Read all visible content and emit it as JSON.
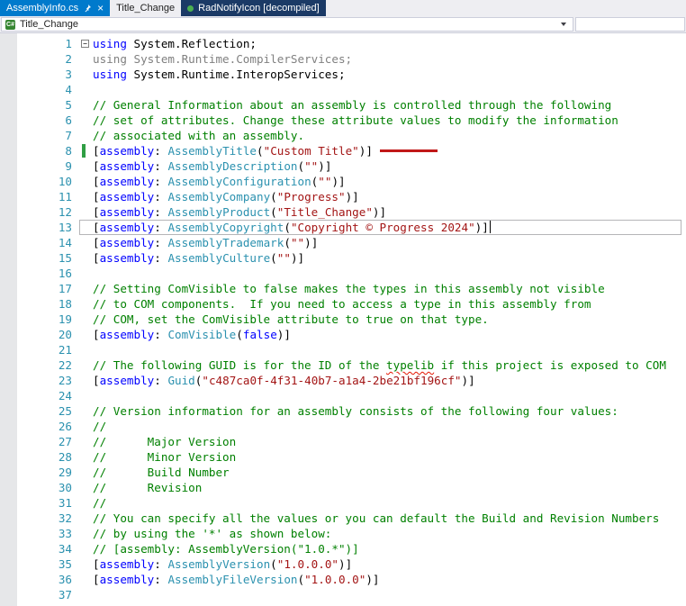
{
  "tabs": [
    {
      "label": "AssemblyInfo.cs",
      "active": true
    },
    {
      "label": "Title_Change",
      "active": false
    },
    {
      "label": "RadNotifyIcon [decompiled]",
      "active": false
    }
  ],
  "navbar": {
    "project_dropdown": {
      "value": "Title_Change",
      "icon": "csharp-project-icon"
    }
  },
  "colors": {
    "active_tab": "#007acc",
    "decompiled_tab": "#1b3a66",
    "keyword": "#0000ff",
    "type": "#2b91af",
    "string": "#a31515",
    "comment": "#008000",
    "unused_code": "#808080",
    "line_number": "#2b91af",
    "change_bar": "#2f9e44",
    "annotation_line": "#c11818",
    "squiggle": "#e51400"
  },
  "editor": {
    "lines": [
      {
        "n": 1,
        "collapse": true,
        "seg": [
          [
            "kw",
            "using"
          ],
          [
            "tx",
            " System.Reflection;"
          ]
        ]
      },
      {
        "n": 2,
        "seg": [
          [
            "gy",
            "using System.Runtime.CompilerServices;"
          ]
        ]
      },
      {
        "n": 3,
        "seg": [
          [
            "kw",
            "using"
          ],
          [
            "tx",
            " System.Runtime.InteropServices;"
          ]
        ]
      },
      {
        "n": 4,
        "seg": []
      },
      {
        "n": 5,
        "seg": [
          [
            "cm",
            "// General Information about an assembly is controlled through the following"
          ]
        ]
      },
      {
        "n": 6,
        "seg": [
          [
            "cm",
            "// set of attributes. Change these attribute values to modify the information"
          ]
        ]
      },
      {
        "n": 7,
        "seg": [
          [
            "cm",
            "// associated with an assembly."
          ]
        ]
      },
      {
        "n": 8,
        "changebar": true,
        "annotation": true,
        "seg": [
          [
            "tx",
            "["
          ],
          [
            "kw",
            "assembly"
          ],
          [
            "tx",
            ": "
          ],
          [
            "ty",
            "AssemblyTitle"
          ],
          [
            "tx",
            "("
          ],
          [
            "st",
            "\"Custom Title\""
          ],
          [
            "tx",
            ")]"
          ]
        ]
      },
      {
        "n": 9,
        "seg": [
          [
            "tx",
            "["
          ],
          [
            "kw",
            "assembly"
          ],
          [
            "tx",
            ": "
          ],
          [
            "ty",
            "AssemblyDescription"
          ],
          [
            "tx",
            "("
          ],
          [
            "st",
            "\"\""
          ],
          [
            "tx",
            ")]"
          ]
        ]
      },
      {
        "n": 10,
        "seg": [
          [
            "tx",
            "["
          ],
          [
            "kw",
            "assembly"
          ],
          [
            "tx",
            ": "
          ],
          [
            "ty",
            "AssemblyConfiguration"
          ],
          [
            "tx",
            "("
          ],
          [
            "st",
            "\"\""
          ],
          [
            "tx",
            ")]"
          ]
        ]
      },
      {
        "n": 11,
        "seg": [
          [
            "tx",
            "["
          ],
          [
            "kw",
            "assembly"
          ],
          [
            "tx",
            ": "
          ],
          [
            "ty",
            "AssemblyCompany"
          ],
          [
            "tx",
            "("
          ],
          [
            "st",
            "\"Progress\""
          ],
          [
            "tx",
            ")]"
          ]
        ]
      },
      {
        "n": 12,
        "seg": [
          [
            "tx",
            "["
          ],
          [
            "kw",
            "assembly"
          ],
          [
            "tx",
            ": "
          ],
          [
            "ty",
            "AssemblyProduct"
          ],
          [
            "tx",
            "("
          ],
          [
            "st",
            "\"Title_Change\""
          ],
          [
            "tx",
            ")]"
          ]
        ]
      },
      {
        "n": 13,
        "current": true,
        "cursor": true,
        "seg": [
          [
            "tx",
            "["
          ],
          [
            "kw",
            "assembly"
          ],
          [
            "tx",
            ": "
          ],
          [
            "ty",
            "AssemblyCopyright"
          ],
          [
            "tx",
            "("
          ],
          [
            "st",
            "\"Copyright © Progress 2024\""
          ],
          [
            "tx",
            ")]"
          ]
        ]
      },
      {
        "n": 14,
        "seg": [
          [
            "tx",
            "["
          ],
          [
            "kw",
            "assembly"
          ],
          [
            "tx",
            ": "
          ],
          [
            "ty",
            "AssemblyTrademark"
          ],
          [
            "tx",
            "("
          ],
          [
            "st",
            "\"\""
          ],
          [
            "tx",
            ")]"
          ]
        ]
      },
      {
        "n": 15,
        "seg": [
          [
            "tx",
            "["
          ],
          [
            "kw",
            "assembly"
          ],
          [
            "tx",
            ": "
          ],
          [
            "ty",
            "AssemblyCulture"
          ],
          [
            "tx",
            "("
          ],
          [
            "st",
            "\"\""
          ],
          [
            "tx",
            ")]"
          ]
        ]
      },
      {
        "n": 16,
        "seg": []
      },
      {
        "n": 17,
        "seg": [
          [
            "cm",
            "// Setting ComVisible to false makes the types in this assembly not visible"
          ]
        ]
      },
      {
        "n": 18,
        "seg": [
          [
            "cm",
            "// to COM components.  If you need to access a type in this assembly from"
          ]
        ]
      },
      {
        "n": 19,
        "seg": [
          [
            "cm",
            "// COM, set the ComVisible attribute to true on that type."
          ]
        ]
      },
      {
        "n": 20,
        "seg": [
          [
            "tx",
            "["
          ],
          [
            "kw",
            "assembly"
          ],
          [
            "tx",
            ": "
          ],
          [
            "ty",
            "ComVisible"
          ],
          [
            "tx",
            "("
          ],
          [
            "kw",
            "false"
          ],
          [
            "tx",
            ")]"
          ]
        ]
      },
      {
        "n": 21,
        "seg": []
      },
      {
        "n": 22,
        "seg": [
          [
            "cm",
            "// The following GUID is for the ID of the "
          ],
          [
            "sq",
            "typelib"
          ],
          [
            "cm",
            " if this project is exposed to COM"
          ]
        ]
      },
      {
        "n": 23,
        "seg": [
          [
            "tx",
            "["
          ],
          [
            "kw",
            "assembly"
          ],
          [
            "tx",
            ": "
          ],
          [
            "ty",
            "Guid"
          ],
          [
            "tx",
            "("
          ],
          [
            "st",
            "\"c487ca0f-4f31-40b7-a1a4-2be21bf196cf\""
          ],
          [
            "tx",
            ")]"
          ]
        ]
      },
      {
        "n": 24,
        "seg": []
      },
      {
        "n": 25,
        "seg": [
          [
            "cm",
            "// Version information for an assembly consists of the following four values:"
          ]
        ]
      },
      {
        "n": 26,
        "seg": [
          [
            "cm",
            "//"
          ]
        ]
      },
      {
        "n": 27,
        "seg": [
          [
            "cm",
            "//      Major Version"
          ]
        ]
      },
      {
        "n": 28,
        "seg": [
          [
            "cm",
            "//      Minor Version"
          ]
        ]
      },
      {
        "n": 29,
        "seg": [
          [
            "cm",
            "//      Build Number"
          ]
        ]
      },
      {
        "n": 30,
        "seg": [
          [
            "cm",
            "//      Revision"
          ]
        ]
      },
      {
        "n": 31,
        "seg": [
          [
            "cm",
            "//"
          ]
        ]
      },
      {
        "n": 32,
        "seg": [
          [
            "cm",
            "// You can specify all the values or you can default the Build and Revision Numbers"
          ]
        ]
      },
      {
        "n": 33,
        "seg": [
          [
            "cm",
            "// by using the '*' as shown below:"
          ]
        ]
      },
      {
        "n": 34,
        "seg": [
          [
            "cm",
            "// [assembly: AssemblyVersion(\"1.0.*\")]"
          ]
        ]
      },
      {
        "n": 35,
        "seg": [
          [
            "tx",
            "["
          ],
          [
            "kw",
            "assembly"
          ],
          [
            "tx",
            ": "
          ],
          [
            "ty",
            "AssemblyVersion"
          ],
          [
            "tx",
            "("
          ],
          [
            "st",
            "\"1.0.0.0\""
          ],
          [
            "tx",
            ")]"
          ]
        ]
      },
      {
        "n": 36,
        "seg": [
          [
            "tx",
            "["
          ],
          [
            "kw",
            "assembly"
          ],
          [
            "tx",
            ": "
          ],
          [
            "ty",
            "AssemblyFileVersion"
          ],
          [
            "tx",
            "("
          ],
          [
            "st",
            "\"1.0.0.0\""
          ],
          [
            "tx",
            ")]"
          ]
        ]
      },
      {
        "n": 37,
        "seg": []
      }
    ]
  }
}
